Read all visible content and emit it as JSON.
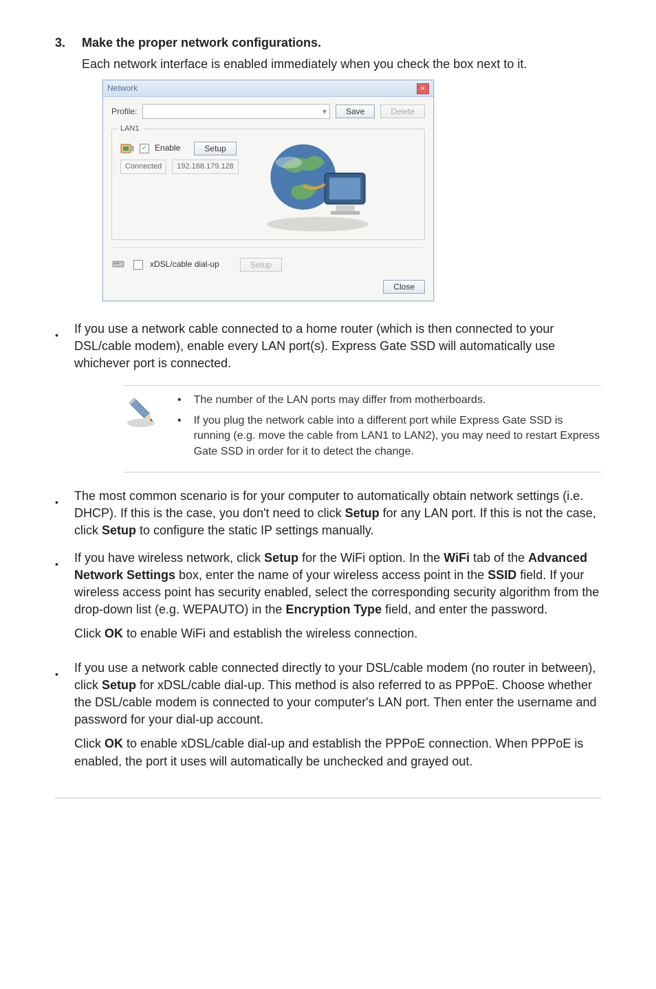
{
  "step": {
    "number": "3.",
    "heading": "Make the proper network configurations.",
    "body": "Each network interface is enabled immediately when you check the box next to it."
  },
  "dialog": {
    "title": "Network",
    "profile_label": "Profile:",
    "combo_arrow": "▾",
    "save": "Save",
    "delete": "Delete",
    "lan_title": "LAN1",
    "enable": "Enable",
    "setup": "Setup",
    "connected": "Connected",
    "ip": "192.168.179.128",
    "dialup_label": "xDSL/cable dial-up",
    "setup2": "Setup",
    "close": "Close",
    "check": "✓"
  },
  "bullets1": {
    "b1": "If you use a network cable connected to a home router (which is then connected to your DSL/cable modem), enable every LAN port(s). Express Gate SSD will automatically use whichever port is connected."
  },
  "note": {
    "n1": "The number of the LAN ports may differ from motherboards.",
    "n2": "If you plug the network cable into a different port while Express Gate SSD is running (e.g. move the cable from LAN1 to LAN2), you may need to restart Express Gate SSD in order for it to detect the change."
  },
  "bullets2": {
    "b1a": "The most common scenario is for your computer to automatically obtain network settings (i.e. DHCP). If this is the case, you don't need to click ",
    "b1_setup": "Setup",
    "b1b": " for any LAN port. If this is not the case, click ",
    "b1_setup2": "Setup",
    "b1c": " to configure the static IP settings manually.",
    "b2a": "If you have wireless network, click ",
    "b2_setup": "Setup",
    "b2b": " for the WiFi option. In the ",
    "b2_wifi": "WiFi",
    "b2c": " tab of the ",
    "b2_adv": "Advanced Network Settings",
    "b2d": " box, enter the name of your wireless access point in the ",
    "b2_ssid": "SSID",
    "b2e": " field. If your wireless access point has security enabled, select the corresponding security algorithm from the drop-down list (e.g. WEPAUTO) in the ",
    "b2_enc": "Encryption Type",
    "b2f": " field, and enter the password.",
    "b2g": "Click ",
    "b2_ok": "OK",
    "b2h": " to enable WiFi and establish the wireless connection.",
    "b3a": "If you use a network cable connected directly to your DSL/cable modem (no router in between), click ",
    "b3_setup": "Setup",
    "b3b": " for xDSL/cable dial-up. This method is also referred to as PPPoE. Choose whether the DSL/cable modem is connected to your computer's LAN port. Then enter the username and password for your dial-up account.",
    "b3c": "Click ",
    "b3_ok": "OK",
    "b3d": " to enable xDSL/cable dial-up and establish the PPPoE connection. When PPPoE is enabled, the port it uses will automatically be unchecked and grayed out."
  }
}
